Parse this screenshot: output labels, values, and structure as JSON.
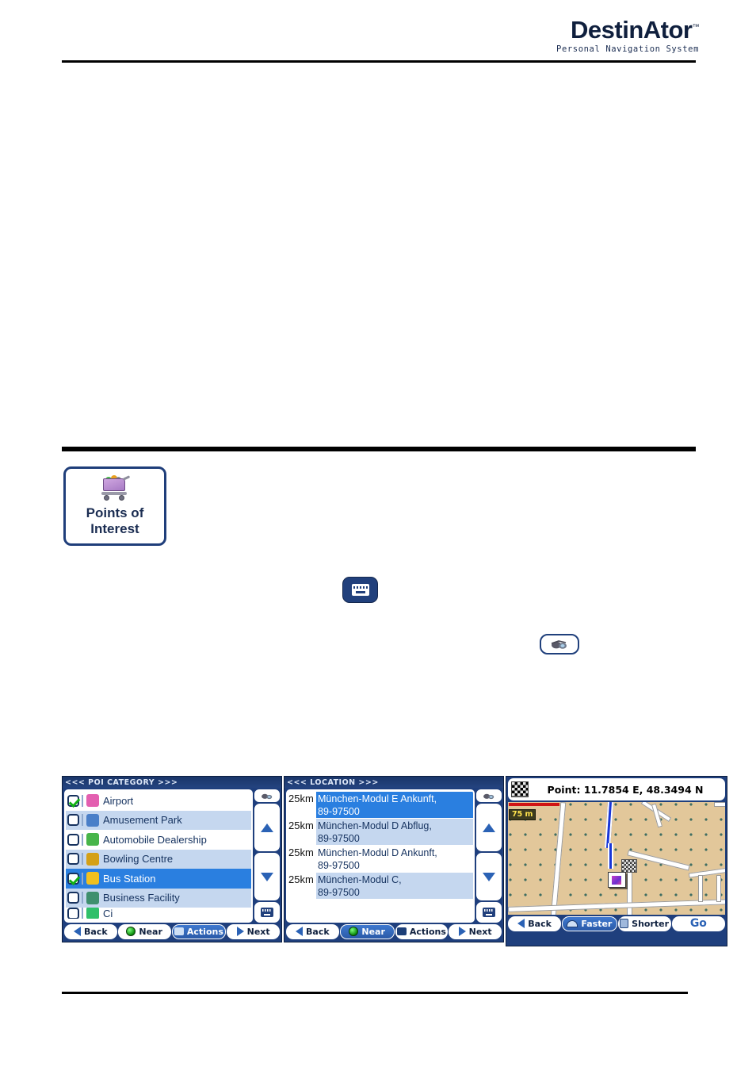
{
  "header": {
    "logo_main": "DestinAtor",
    "logo_tm": "™",
    "logo_sub": "Personal Navigation System"
  },
  "poi_button": {
    "icon": "shopping-cart-icon",
    "label_line1": "Points of",
    "label_line2": "Interest"
  },
  "inline_icons": {
    "keyboard": "keyboard-icon",
    "glasses": "binoculars-icon"
  },
  "poi_category_panel": {
    "title": "<<<  POI CATEGORY  >>>",
    "rows": [
      {
        "label": "Airport",
        "checked": true,
        "alt": false,
        "selected": false,
        "icon_color": "#e35fb0",
        "icon": "airport-icon"
      },
      {
        "label": "Amusement Park",
        "checked": false,
        "alt": true,
        "selected": false,
        "icon_color": "#4a7fc8",
        "icon": "amusement-park-icon"
      },
      {
        "label": "Automobile Dealership",
        "checked": false,
        "alt": false,
        "selected": false,
        "icon_color": "#47b54a",
        "icon": "car-dealership-icon"
      },
      {
        "label": "Bowling Centre",
        "checked": false,
        "alt": true,
        "selected": false,
        "icon_color": "#d4a017",
        "icon": "bowling-icon"
      },
      {
        "label": "Bus Station",
        "checked": true,
        "alt": false,
        "selected": true,
        "icon_color": "#f0c020",
        "icon": "bus-station-icon"
      },
      {
        "label": "Business Facility",
        "checked": false,
        "alt": true,
        "selected": false,
        "icon_color": "#3e8f6e",
        "icon": "business-facility-icon"
      },
      {
        "label": "Ci",
        "checked": false,
        "alt": false,
        "selected": false,
        "icon_color": "#2fc06a",
        "icon": "city-icon"
      }
    ],
    "side_controls": {
      "glasses": "binoculars-icon",
      "up": "scroll-up-arrow",
      "down": "scroll-down-arrow",
      "keyboard": "keyboard-icon"
    },
    "toolbar": {
      "back": "Back",
      "near": "Near",
      "actions": "Actions",
      "next": "Next",
      "active": "actions"
    }
  },
  "location_panel": {
    "title": "<<<  LOCATION  >>>",
    "rows": [
      {
        "distance": "25km",
        "line1": "München-Modul E Ankunft,",
        "line2": "89-97500",
        "alt": false,
        "selected": true
      },
      {
        "distance": "25km",
        "line1": "München-Modul D Abflug,",
        "line2": "89-97500",
        "alt": true,
        "selected": false
      },
      {
        "distance": "25km",
        "line1": "München-Modul D Ankunft,",
        "line2": "89-97500",
        "alt": false,
        "selected": false
      },
      {
        "distance": "25km",
        "line1": "München-Modul C,",
        "line2": "89-97500",
        "alt": true,
        "selected": false
      }
    ],
    "side_controls": {
      "glasses": "binoculars-icon",
      "up": "scroll-up-arrow",
      "down": "scroll-down-arrow",
      "keyboard": "keyboard-icon"
    },
    "toolbar": {
      "back": "Back",
      "near": "Near",
      "actions": "Actions",
      "next": "Next",
      "active": "near"
    }
  },
  "map_panel": {
    "flag_icon": "checkered-flag-icon",
    "coordinate_text": "Point: 11.7854 E, 48.3494 N",
    "scale_label": "75 m",
    "destination_icon": "checkered-destination-flag",
    "vehicle_icon": "vehicle-marker-icon",
    "toolbar": {
      "back": "Back",
      "faster": "Faster",
      "shorter": "Shorter",
      "go": "Go",
      "active": "faster"
    }
  },
  "colors": {
    "panel_frame": "#1f3f7d",
    "selection_blue": "#2a7fe0",
    "alt_row": "#c5d7ef",
    "title_text": "#dce6f7",
    "go_blue": "#2b62b5",
    "map_land": "#e2c79a",
    "route_blue": "#1836d8",
    "scale_yellow": "#ffe34d"
  }
}
